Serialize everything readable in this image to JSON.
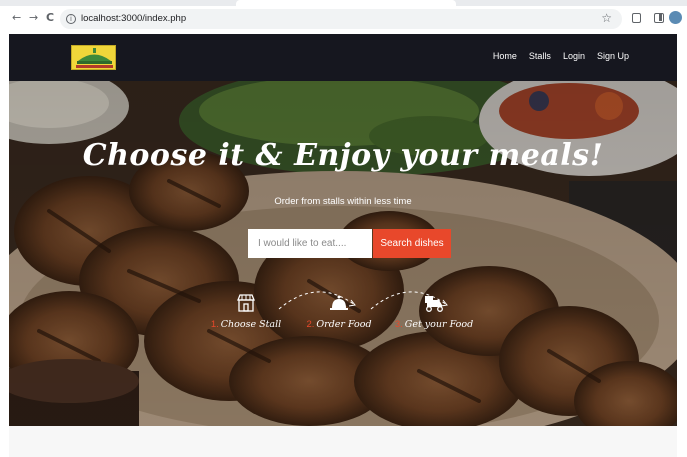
{
  "browser": {
    "url": "localhost:3000/index.php",
    "nav_icons": {
      "back": "arrow-left-icon",
      "forward": "arrow-right-icon",
      "reload": "reload-icon"
    },
    "back_glyph": "←",
    "forward_glyph": "→",
    "reload_glyph": "C"
  },
  "navbar": {
    "logo_alt": "logo",
    "links": [
      "Home",
      "Stalls",
      "Login",
      "Sign Up"
    ]
  },
  "hero": {
    "title": "Choose it & Enjoy your meals!",
    "subtitle": "Order from stalls within less time",
    "search_placeholder": "I would like to eat....",
    "search_button": "Search dishes",
    "steps": [
      {
        "number": "1.",
        "label": "Choose Stall",
        "icon": "store-icon"
      },
      {
        "number": "2.",
        "label": "Order Food",
        "icon": "cloche-icon"
      },
      {
        "number": "3.",
        "label": "Get your Food",
        "icon": "delivery-scooter-icon"
      }
    ]
  },
  "colors": {
    "navbar_bg": "#16171f",
    "accent": "#e8482b",
    "logo_bg": "#f0d63a"
  }
}
